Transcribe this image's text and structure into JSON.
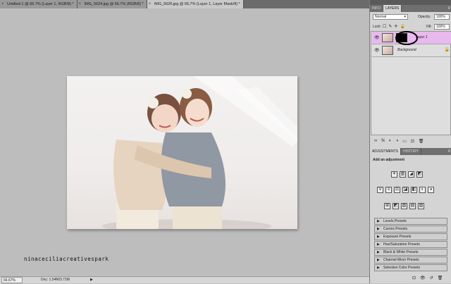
{
  "tabs": [
    {
      "label": "Untitled-1 @ 66.7% (Layer 1, RGB/8) *"
    },
    {
      "label": "IMG_5624.jpg @ 66.7% (RGB/8) *"
    },
    {
      "label": "IMG_5626.jpg @ 66.7% (Layer 1, Layer Mask/8) *"
    }
  ],
  "watermark": "ninaceciliacreativespark",
  "status": {
    "zoom": "66.67%",
    "doc": "Doc: 1.54M/3.71M",
    "arrow": "▶"
  },
  "layers_panel": {
    "tabs": [
      "INFO",
      "LAYERS"
    ],
    "blend_mode": "Normal",
    "opacity_label": "Opacity:",
    "opacity": "100%",
    "lock_label": "Lock:",
    "fill_label": "Fill:",
    "fill": "100%",
    "layers": [
      {
        "name": "Layer 1"
      },
      {
        "name": "Background"
      }
    ],
    "bottom_icons": [
      "∞",
      "fx",
      "◐",
      "◑",
      "▭",
      "⊡",
      "🗑"
    ]
  },
  "adjustments_panel": {
    "tabs": [
      "ADJUSTMENTS",
      "HISTORY"
    ],
    "heading": "Add an adjustment",
    "icon_rows": [
      [
        "☀",
        "▥",
        "◢",
        "◩"
      ],
      [
        "V",
        "≡",
        "⚖",
        "◪",
        "◧",
        "◐",
        "◕"
      ],
      [
        "⊞",
        "◩",
        "▨",
        "▤",
        "▧"
      ]
    ],
    "presets": [
      "Levels Presets",
      "Curves Presets",
      "Exposure Presets",
      "Hue/Saturation Presets",
      "Black & White Presets",
      "Channel Mixer Presets",
      "Selective Color Presets"
    ]
  }
}
